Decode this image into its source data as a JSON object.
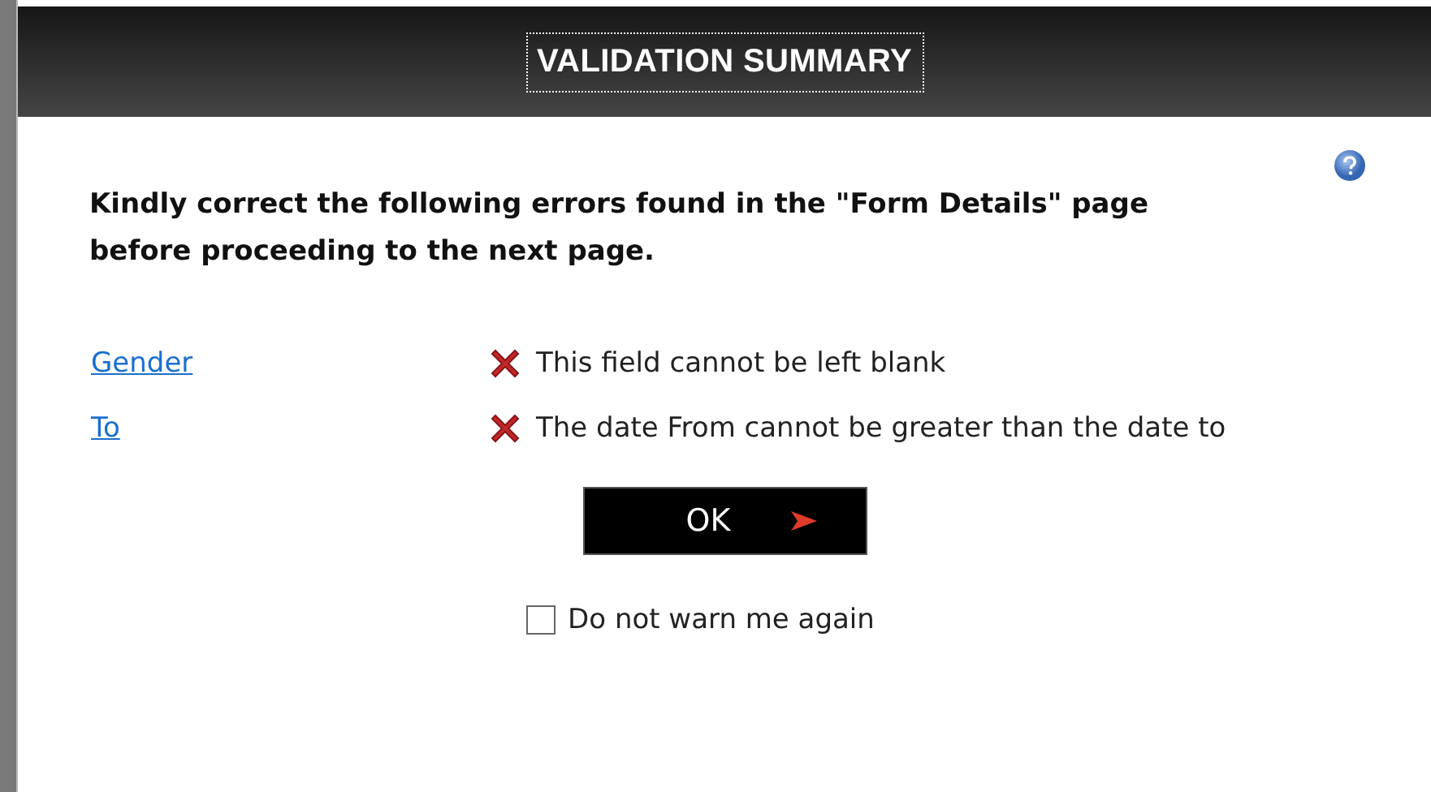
{
  "dialog": {
    "title": "VALIDATION SUMMARY"
  },
  "message": "Kindly correct the following errors found in the \"Form Details\" page before proceeding to the next page.",
  "errors": [
    {
      "field": "Gender",
      "text": "This field cannot be left blank"
    },
    {
      "field": "To",
      "text": "The date From cannot be greater than the date to"
    }
  ],
  "ok_button": {
    "label": "OK"
  },
  "dont_warn": {
    "label": "Do not warn me again",
    "checked": false
  }
}
